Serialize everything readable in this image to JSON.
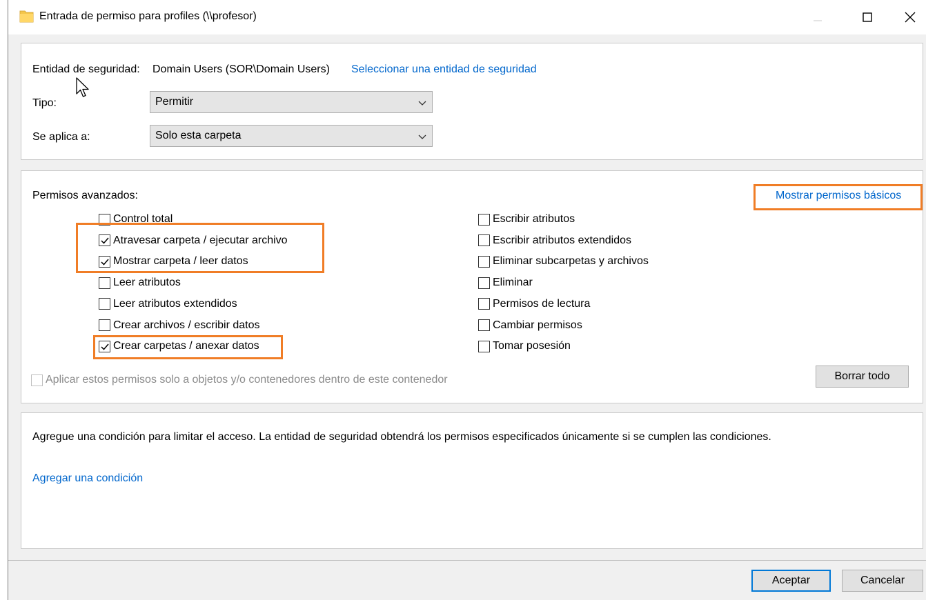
{
  "window": {
    "title": "Entrada de permiso para profiles (\\\\profesor)"
  },
  "principal": {
    "label": "Entidad de seguridad:",
    "value": "Domain Users (SOR\\Domain Users)",
    "select_link": "Seleccionar una entidad de seguridad"
  },
  "type": {
    "label": "Tipo:",
    "value": "Permitir"
  },
  "applies_to": {
    "label": "Se aplica a:",
    "value": "Solo esta carpeta"
  },
  "advanced": {
    "heading": "Permisos avanzados:",
    "show_basic_link": "Mostrar permisos básicos",
    "left_permissions": [
      {
        "label": "Control total",
        "checked": false
      },
      {
        "label": "Atravesar carpeta / ejecutar archivo",
        "checked": true
      },
      {
        "label": "Mostrar carpeta / leer datos",
        "checked": true
      },
      {
        "label": "Leer atributos",
        "checked": false
      },
      {
        "label": "Leer atributos extendidos",
        "checked": false
      },
      {
        "label": "Crear archivos / escribir datos",
        "checked": false
      },
      {
        "label": "Crear carpetas / anexar datos",
        "checked": true
      }
    ],
    "right_permissions": [
      {
        "label": "Escribir atributos",
        "checked": false
      },
      {
        "label": "Escribir atributos extendidos",
        "checked": false
      },
      {
        "label": "Eliminar subcarpetas y archivos",
        "checked": false
      },
      {
        "label": "Eliminar",
        "checked": false
      },
      {
        "label": "Permisos de lectura",
        "checked": false
      },
      {
        "label": "Cambiar permisos",
        "checked": false
      },
      {
        "label": "Tomar posesión",
        "checked": false
      }
    ],
    "apply_only_label": "Aplicar estos permisos solo a objetos y/o contenedores dentro de este contenedor",
    "clear_all_label": "Borrar todo"
  },
  "condition": {
    "description": "Agregue una condición para limitar el acceso. La entidad de seguridad obtendrá los permisos especificados únicamente si se cumplen las condiciones.",
    "add_link": "Agregar una condición"
  },
  "footer": {
    "ok_label": "Aceptar",
    "cancel_label": "Cancelar"
  },
  "colors": {
    "link": "#0066cc",
    "highlight": "#f07d26",
    "accent": "#0078d7"
  }
}
